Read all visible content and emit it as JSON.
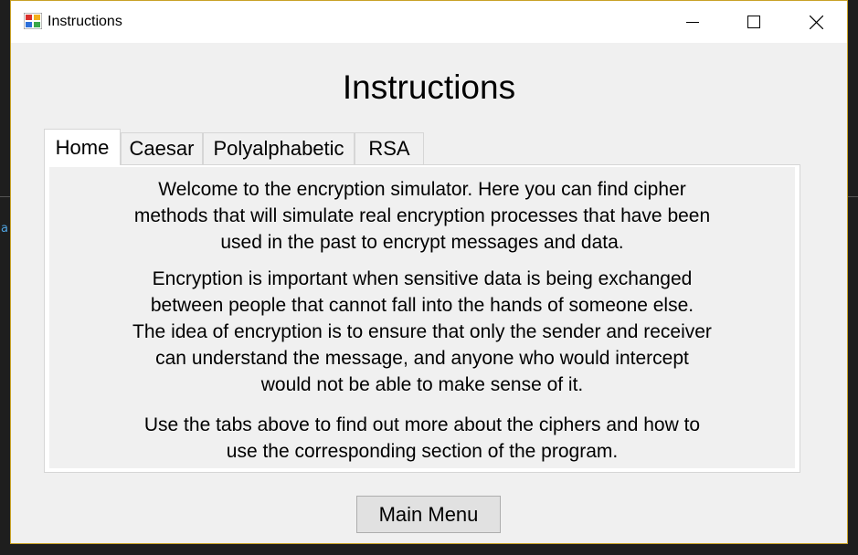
{
  "window": {
    "title": "Instructions",
    "controls": {
      "minimize_icon": "minimize-icon",
      "maximize_icon": "maximize-icon",
      "close_icon": "close-icon"
    },
    "accent_border": "#c9a227"
  },
  "background": {
    "partial_char": "a"
  },
  "heading": "Instructions",
  "tabs": [
    {
      "label": "Home",
      "selected": true
    },
    {
      "label": "Caesar",
      "selected": false
    },
    {
      "label": "Polyalphabetic",
      "selected": false
    },
    {
      "label": "RSA",
      "selected": false
    }
  ],
  "home_panel": {
    "paragraph1": [
      "Welcome to the encryption simulator. Here you can find cipher",
      "methods that will simulate real encryption processes that have been",
      "used in the past to encrypt messages and data."
    ],
    "paragraph2": [
      "Encryption is important when sensitive data is being exchanged",
      "between people that cannot fall into the hands of someone else.",
      "The idea of encryption is to ensure that only the sender and receiver",
      "can understand the message, and anyone who would intercept",
      "would not be able to make sense of it."
    ],
    "paragraph3": [
      "Use the tabs above to find out more about the ciphers and how to",
      "use the corresponding section of the program."
    ]
  },
  "main_menu_button": "Main Menu"
}
